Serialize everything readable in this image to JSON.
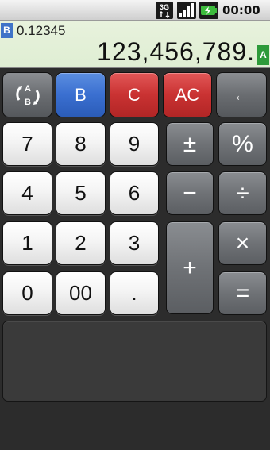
{
  "status_bar": {
    "network_type": "3G",
    "time": "00:00",
    "icons": [
      "network-3g-icon",
      "signal-icon",
      "battery-charging-icon"
    ]
  },
  "display": {
    "memory_register_label": "B",
    "memory_value": "0.12345",
    "main_register_label": "A",
    "main_value": "123,456,789."
  },
  "keys": {
    "swap": "swap-ab-icon",
    "b": "B",
    "c": "C",
    "ac": "AC",
    "backspace": "←",
    "seven": "7",
    "eight": "8",
    "nine": "9",
    "plus_minus": "±",
    "percent": "%",
    "four": "4",
    "five": "5",
    "six": "6",
    "minus": "−",
    "divide": "÷",
    "one": "1",
    "two": "2",
    "three": "3",
    "plus": "+",
    "multiply": "×",
    "zero": "0",
    "double_zero": "00",
    "decimal": ".",
    "equals": "="
  },
  "colors": {
    "register_b_badge": "#3f73c8",
    "register_a_badge": "#2e9a3a",
    "key_blue": "#3a6fd0",
    "key_red": "#c93232",
    "key_gray": "#6f7276",
    "display_bg": "#e4f0d8"
  }
}
